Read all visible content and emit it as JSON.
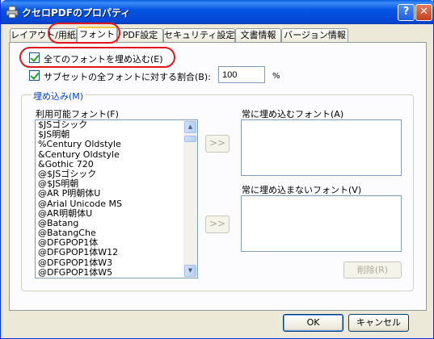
{
  "window": {
    "title": "クセロPDFのプロパティ",
    "help_label": "?",
    "close_label": "✕"
  },
  "tabs": [
    {
      "label": "レイアウト/用紙"
    },
    {
      "label": "フォント",
      "active": true
    },
    {
      "label": "PDF設定"
    },
    {
      "label": "セキュリティ設定"
    },
    {
      "label": "文書情報"
    },
    {
      "label": "バージョン情報"
    }
  ],
  "options": {
    "embed_all_label": "全てのフォントを埋め込む(E)",
    "embed_all_checked": true,
    "subset_label": "サブセットの全フォントに対する割合(B):",
    "subset_checked": true,
    "subset_value": "100",
    "percent_label": "%"
  },
  "embed_group": {
    "title": "埋め込み(M)",
    "available_label": "利用可能フォント(F)",
    "available_fonts": [
      "$JSゴシック",
      "$JS明朝",
      "%Century Oldstyle",
      "&Century Oldstyle",
      "&Gothic 720",
      "@$JSゴシック",
      "@$JS明朝",
      "@AR P明朝体U",
      "@Arial Unicode MS",
      "@AR明朝体U",
      "@Batang",
      "@BatangChe",
      "@DFGPOP1体",
      "@DFGPOP1体W12",
      "@DFGPOP1体W3",
      "@DFGPOP1体W5"
    ],
    "add_embed_label": ">>",
    "add_noembed_label": ">>",
    "always_embed_label": "常に埋め込むフォント(A)",
    "never_embed_label": "常に埋め込まないフォント(V)",
    "delete_label": "削除(R)"
  },
  "footer": {
    "ok_label": "OK",
    "cancel_label": "キャンセル"
  },
  "colors": {
    "titlebar": "#0554e2",
    "highlight_circle": "#e0161e",
    "group_title": "#0046d5"
  },
  "icons": {
    "title": "printer-icon",
    "scroll_up": "arrow-up-icon",
    "scroll_down": "arrow-down-icon"
  }
}
